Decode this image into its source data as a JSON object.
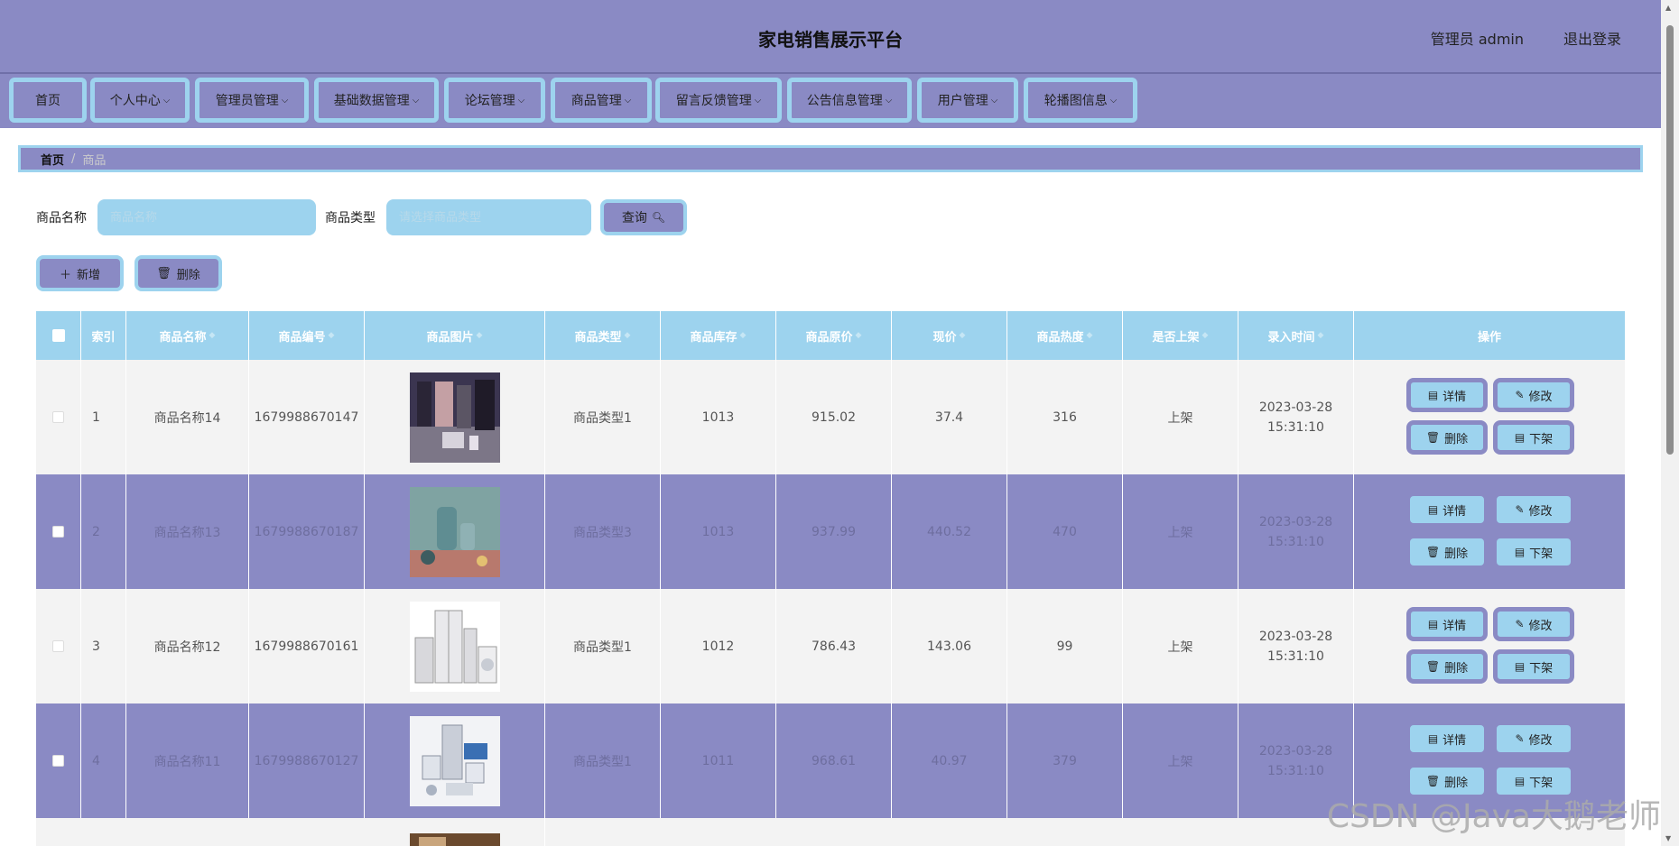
{
  "header": {
    "title": "家电销售展示平台",
    "user": "管理员 admin",
    "logout": "退出登录"
  },
  "nav": [
    {
      "label": "首页",
      "has_dropdown": false
    },
    {
      "label": "个人中心",
      "has_dropdown": true
    },
    {
      "label": "管理员管理",
      "has_dropdown": true
    },
    {
      "label": "基础数据管理",
      "has_dropdown": true
    },
    {
      "label": "论坛管理",
      "has_dropdown": true
    },
    {
      "label": "商品管理",
      "has_dropdown": true
    },
    {
      "label": "留言反馈管理",
      "has_dropdown": true
    },
    {
      "label": "公告信息管理",
      "has_dropdown": true
    },
    {
      "label": "用户管理",
      "has_dropdown": true
    },
    {
      "label": "轮播图信息",
      "has_dropdown": true
    }
  ],
  "breadcrumb": {
    "home": "首页",
    "separator": "/",
    "current": "商品"
  },
  "search": {
    "name_label": "商品名称",
    "name_placeholder": "商品名称",
    "type_label": "商品类型",
    "type_placeholder": "请选择商品类型",
    "query_label": "查询"
  },
  "toolbar": {
    "add_label": "新增",
    "delete_label": "删除"
  },
  "table": {
    "headers": [
      "索引",
      "商品名称",
      "商品编号",
      "商品图片",
      "商品类型",
      "商品库存",
      "商品原价",
      "现价",
      "商品热度",
      "是否上架",
      "录入时间",
      "操作"
    ],
    "rows": [
      {
        "index": "1",
        "name": "商品名称14",
        "code": "1679988670147",
        "type": "商品类型1",
        "stock": "1013",
        "original_price": "915.02",
        "price": "37.4",
        "heat": "316",
        "on_shelf": "上架",
        "time": "2023-03-28 15:31:10"
      },
      {
        "index": "2",
        "name": "商品名称13",
        "code": "1679988670187",
        "type": "商品类型3",
        "stock": "1013",
        "original_price": "937.99",
        "price": "440.52",
        "heat": "470",
        "on_shelf": "上架",
        "time": "2023-03-28 15:31:10"
      },
      {
        "index": "3",
        "name": "商品名称12",
        "code": "1679988670161",
        "type": "商品类型1",
        "stock": "1012",
        "original_price": "786.43",
        "price": "143.06",
        "heat": "99",
        "on_shelf": "上架",
        "time": "2023-03-28 15:31:10"
      },
      {
        "index": "4",
        "name": "商品名称11",
        "code": "1679988670127",
        "type": "商品类型1",
        "stock": "1011",
        "original_price": "968.61",
        "price": "40.97",
        "heat": "379",
        "on_shelf": "上架",
        "time": "2023-03-28 15:31:10"
      }
    ],
    "actions": {
      "detail": "详情",
      "edit": "修改",
      "delete": "删除",
      "offshelf": "下架"
    }
  },
  "watermark": "CSDN @Java大鹅老师",
  "colors": {
    "primary": "#8a8ac4",
    "accent": "#9dd3ee",
    "row_light": "#f3f3f3"
  }
}
